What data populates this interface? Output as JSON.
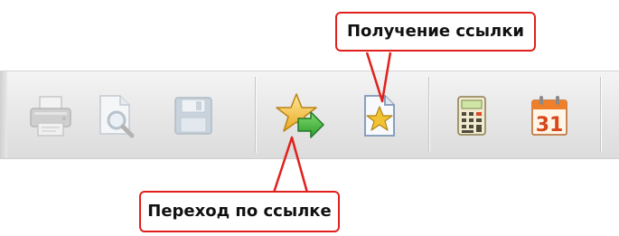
{
  "callouts": {
    "get_link": "Получение ссылки",
    "follow_link": "Переход по ссылке"
  },
  "toolbar": {
    "buttons": [
      {
        "icon": "printer-icon",
        "state": "disabled"
      },
      {
        "icon": "print-preview-icon",
        "state": "disabled"
      },
      {
        "icon": "save-icon",
        "state": "disabled"
      },
      {
        "icon": "star-arrow-icon",
        "state": "enabled"
      },
      {
        "icon": "star-document-icon",
        "state": "enabled"
      },
      {
        "icon": "calculator-icon",
        "state": "enabled"
      },
      {
        "icon": "calendar-icon",
        "state": "enabled"
      }
    ],
    "calendar_day": "31"
  },
  "colors": {
    "callout_border": "#e0201c",
    "toolbar_bg": "#e6e6e6",
    "star": "#f0c030",
    "arrow": "#3aa63a"
  }
}
